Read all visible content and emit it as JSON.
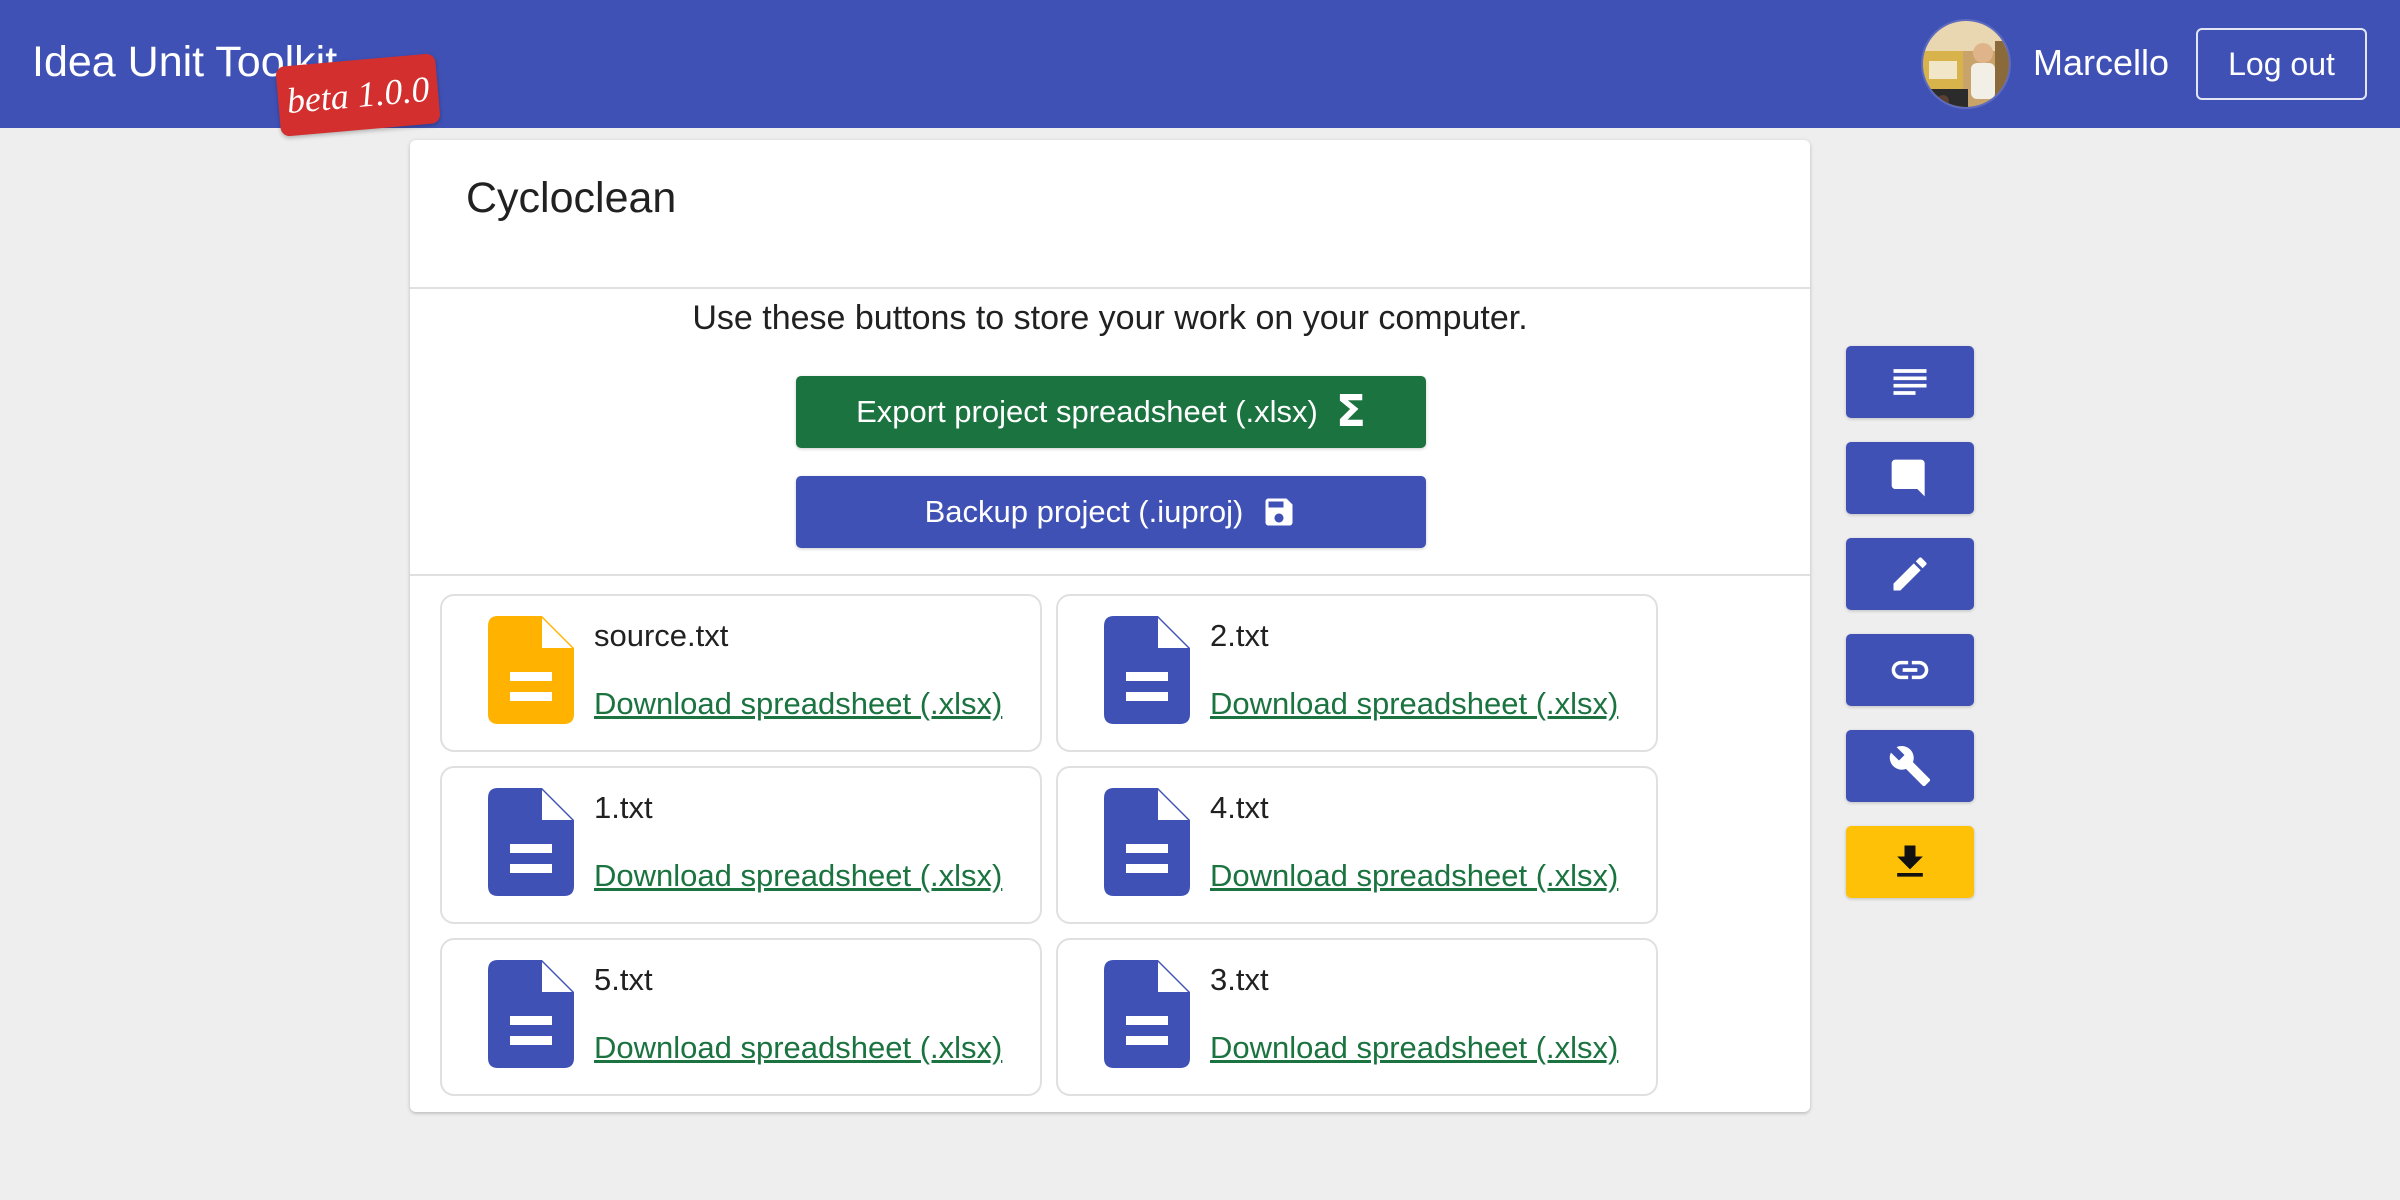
{
  "header": {
    "app_title": "Idea Unit Toolkit",
    "beta_label": "beta 1.0.0",
    "user_name": "Marcello",
    "logout_label": "Log out"
  },
  "project": {
    "title": "Cycloclean",
    "info_text": "Use these buttons to store your work on your computer.",
    "export_label": "Export project spreadsheet (.xlsx)",
    "backup_label": "Backup project (.iuproj)"
  },
  "files": [
    {
      "name": "source.txt",
      "link": "Download spreadsheet (.xlsx)",
      "icon": "document-icon",
      "color": "#ffb300"
    },
    {
      "name": "2.txt",
      "link": "Download spreadsheet (.xlsx)",
      "icon": "document-icon",
      "color": "#3f51b5"
    },
    {
      "name": "1.txt",
      "link": "Download spreadsheet (.xlsx)",
      "icon": "document-icon",
      "color": "#3f51b5"
    },
    {
      "name": "4.txt",
      "link": "Download spreadsheet (.xlsx)",
      "icon": "document-icon",
      "color": "#3f51b5"
    },
    {
      "name": "5.txt",
      "link": "Download spreadsheet (.xlsx)",
      "icon": "document-icon",
      "color": "#3f51b5"
    },
    {
      "name": "3.txt",
      "link": "Download spreadsheet (.xlsx)",
      "icon": "document-icon",
      "color": "#3f51b5"
    }
  ],
  "toolbar": {
    "items": [
      {
        "icon": "text-lines-icon",
        "active": false
      },
      {
        "icon": "comment-icon",
        "active": false
      },
      {
        "icon": "pencil-icon",
        "active": false
      },
      {
        "icon": "link-icon",
        "active": false
      },
      {
        "icon": "wrench-icon",
        "active": false
      },
      {
        "icon": "download-icon",
        "active": true
      }
    ]
  },
  "colors": {
    "primary": "#3f51b5",
    "export_green": "#1b7340",
    "accent_yellow": "#ffc107",
    "beta_red": "#d32f2f",
    "background": "#eeeeee"
  }
}
